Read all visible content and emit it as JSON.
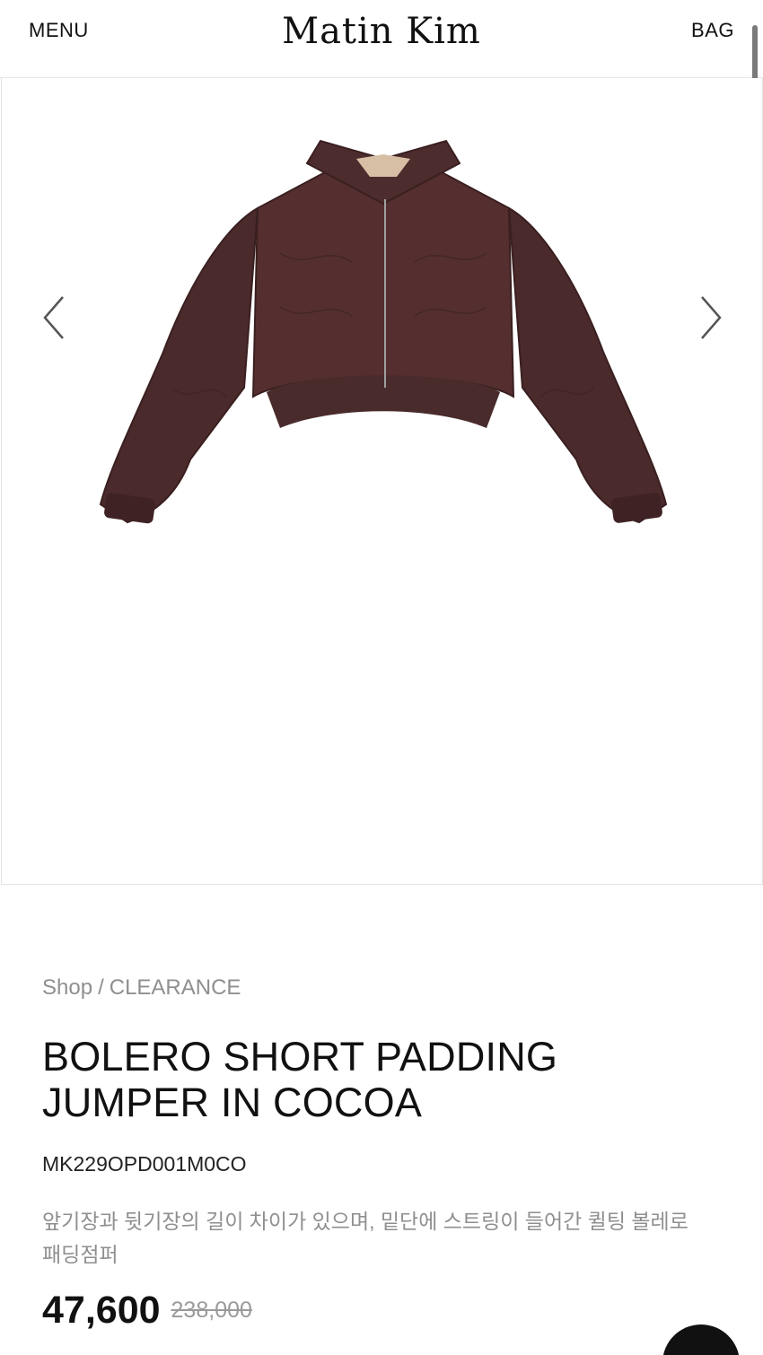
{
  "header": {
    "menu_label": "MENU",
    "logo_text": "Matin Kim",
    "bag_label": "BAG"
  },
  "gallery": {
    "prev_icon": "chevron-left-icon",
    "next_icon": "chevron-right-icon",
    "jacket_color": "#4a2a2b"
  },
  "breadcrumb": {
    "shop": "Shop",
    "separator": "/",
    "category": "CLEARANCE"
  },
  "product": {
    "title": "BOLERO SHORT PADDING JUMPER IN COCOA",
    "sku": "MK229OPD001M0CO",
    "description": "앞기장과 뒷기장의 길이 차이가 있으며, 밑단에 스트링이 들어간 퀼팅 볼레로 패딩점퍼",
    "price": "47,600",
    "original_price": "238,000"
  }
}
